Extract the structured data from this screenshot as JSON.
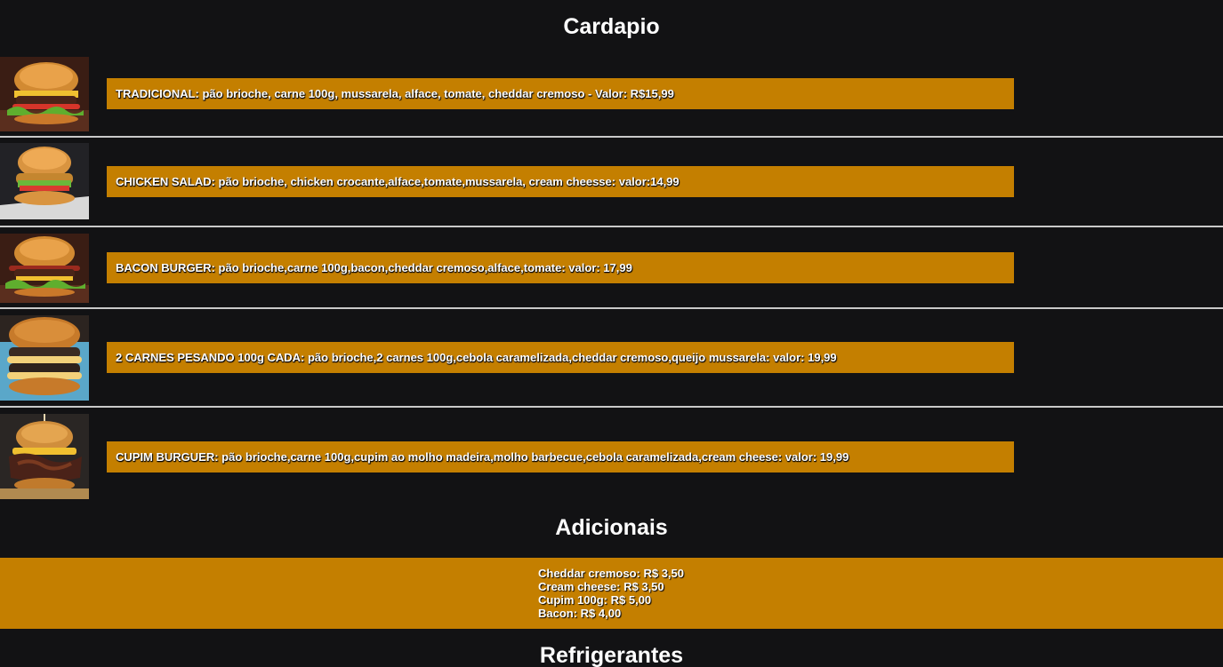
{
  "sections": {
    "menu_title": "Cardapio",
    "extras_title": "Adicionais",
    "drinks_title": "Refrigerantes"
  },
  "menu": {
    "items": [
      {
        "image": "burger-photo",
        "description": "TRADICIONAL: pão brioche, carne 100g, mussarela, alface, tomate, cheddar cremoso - Valor: R$15,99"
      },
      {
        "image": "chicken-burger-photo",
        "description": "CHICKEN SALAD: pão brioche, chicken crocante,alface,tomate,mussarela, cream cheesse: valor:14,99"
      },
      {
        "image": "bacon-burger-photo",
        "description": "BACON BURGER: pão brioche,carne 100g,bacon,cheddar cremoso,alface,tomate: valor: 17,99"
      },
      {
        "image": "double-burger-photo",
        "description": "2 CARNES PESANDO 100g CADA: pão brioche,2 carnes 100g,cebola caramelizada,cheddar cremoso,queijo mussarela: valor: 19,99"
      },
      {
        "image": "cupim-burger-photo",
        "description": "CUPIM BURGUER: pão brioche,carne 100g,cupim ao molho madeira,molho barbecue,cebola caramelizada,cream cheese: valor: 19,99"
      }
    ]
  },
  "extras": {
    "items": [
      "Cheddar cremoso: R$ 3,50",
      "Cream cheese: R$ 3,50",
      "Cupim 100g: R$ 5,00",
      "Bacon: R$ 4,00"
    ]
  },
  "colors": {
    "background": "#121214",
    "accent": "#c47f00",
    "text": "#ffffff",
    "divider": "#c9c9c9"
  }
}
